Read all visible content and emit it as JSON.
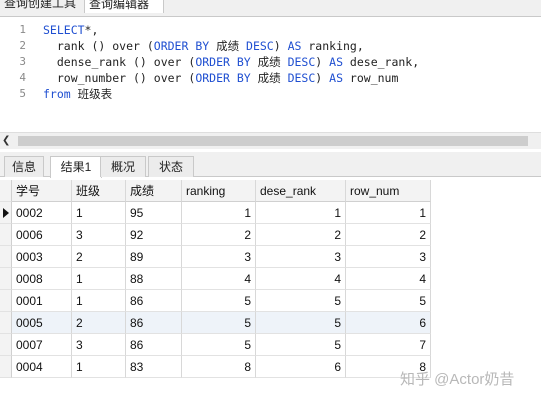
{
  "tabs": {
    "query_builder": "查询创建工具",
    "query_editor": "查询编辑器"
  },
  "editor": {
    "line_numbers": [
      "1",
      "2",
      "3",
      "4",
      "5"
    ],
    "lines": [
      [
        {
          "t": "SELECT",
          "k": true
        },
        {
          "t": "*,",
          "k": false
        }
      ],
      [
        {
          "t": "  rank () over (",
          "k": false
        },
        {
          "t": "ORDER BY",
          "k": true
        },
        {
          "t": " 成绩 ",
          "k": false
        },
        {
          "t": "DESC",
          "k": true
        },
        {
          "t": ") ",
          "k": false
        },
        {
          "t": "AS",
          "k": true
        },
        {
          "t": " ranking,",
          "k": false
        }
      ],
      [
        {
          "t": "  dense_rank () over (",
          "k": false
        },
        {
          "t": "ORDER BY",
          "k": true
        },
        {
          "t": " 成绩 ",
          "k": false
        },
        {
          "t": "DESC",
          "k": true
        },
        {
          "t": ") ",
          "k": false
        },
        {
          "t": "AS",
          "k": true
        },
        {
          "t": " dese_rank,",
          "k": false
        }
      ],
      [
        {
          "t": "  row_number () over (",
          "k": false
        },
        {
          "t": "ORDER BY",
          "k": true
        },
        {
          "t": " 成绩 ",
          "k": false
        },
        {
          "t": "DESC",
          "k": true
        },
        {
          "t": ") ",
          "k": false
        },
        {
          "t": "AS",
          "k": true
        },
        {
          "t": " row_num",
          "k": false
        }
      ],
      [
        {
          "t": "from",
          "k": true
        },
        {
          "t": " 班级表",
          "k": false
        }
      ]
    ]
  },
  "result_tabs": [
    "信息",
    "结果1",
    "概况",
    "状态"
  ],
  "grid": {
    "columns": [
      "学号",
      "班级",
      "成绩",
      "ranking",
      "dese_rank",
      "row_num"
    ],
    "rows": [
      [
        "0002",
        "1",
        "95",
        "1",
        "1",
        "1"
      ],
      [
        "0006",
        "3",
        "92",
        "2",
        "2",
        "2"
      ],
      [
        "0003",
        "2",
        "89",
        "3",
        "3",
        "3"
      ],
      [
        "0008",
        "1",
        "88",
        "4",
        "4",
        "4"
      ],
      [
        "0001",
        "1",
        "86",
        "5",
        "5",
        "5"
      ],
      [
        "0005",
        "2",
        "86",
        "5",
        "5",
        "6"
      ],
      [
        "0007",
        "3",
        "86",
        "5",
        "5",
        "7"
      ],
      [
        "0004",
        "1",
        "83",
        "8",
        "6",
        "8"
      ]
    ]
  },
  "watermark": "知乎 @Actor奶昔",
  "colors": {
    "keyword": "#1f4fd1",
    "selected_row": "#eef3f9"
  }
}
